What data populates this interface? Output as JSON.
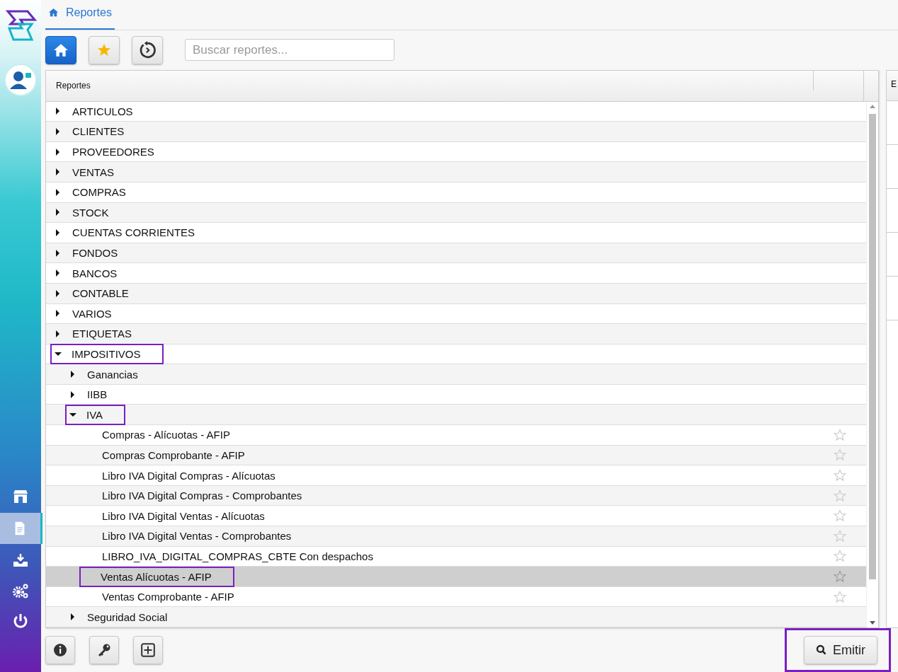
{
  "tab": {
    "label": "Reportes",
    "selected": true
  },
  "search": {
    "placeholder": "Buscar reportes..."
  },
  "table": {
    "column_1": "Reportes",
    "tree": [
      {
        "label": "ARTICULOS",
        "expanded": false,
        "highlighted": false
      },
      {
        "label": "CLIENTES",
        "expanded": false,
        "highlighted": false
      },
      {
        "label": "PROVEEDORES",
        "expanded": false,
        "highlighted": false
      },
      {
        "label": "VENTAS",
        "expanded": false,
        "highlighted": false
      },
      {
        "label": "COMPRAS",
        "expanded": false,
        "highlighted": false
      },
      {
        "label": "STOCK",
        "expanded": false,
        "highlighted": false
      },
      {
        "label": "CUENTAS CORRIENTES",
        "expanded": false,
        "highlighted": false
      },
      {
        "label": "FONDOS",
        "expanded": false,
        "highlighted": false
      },
      {
        "label": "BANCOS",
        "expanded": false,
        "highlighted": false
      },
      {
        "label": "CONTABLE",
        "expanded": false,
        "highlighted": false
      },
      {
        "label": "VARIOS",
        "expanded": false,
        "highlighted": false
      },
      {
        "label": "ETIQUETAS",
        "expanded": false,
        "highlighted": false
      },
      {
        "label": "IMPOSITIVOS",
        "expanded": true,
        "highlighted": true,
        "children": [
          {
            "label": "Ganancias",
            "expanded": false,
            "highlighted": false
          },
          {
            "label": "IIBB",
            "expanded": false,
            "highlighted": false
          },
          {
            "label": "IVA",
            "expanded": true,
            "highlighted": true,
            "children": [
              {
                "label": "Compras - Alícuotas - AFIP",
                "favorite": false,
                "selected": false,
                "highlighted": false
              },
              {
                "label": "Compras Comprobante - AFIP",
                "favorite": false,
                "selected": false,
                "highlighted": false
              },
              {
                "label": "Libro IVA Digital Compras - Alícuotas",
                "favorite": false,
                "selected": false,
                "highlighted": false
              },
              {
                "label": "Libro IVA Digital Compras - Comprobantes",
                "favorite": false,
                "selected": false,
                "highlighted": false
              },
              {
                "label": "Libro IVA Digital Ventas - Alícuotas",
                "favorite": false,
                "selected": false,
                "highlighted": false
              },
              {
                "label": "Libro IVA Digital Ventas - Comprobantes",
                "favorite": false,
                "selected": false,
                "highlighted": false
              },
              {
                "label": "LIBRO_IVA_DIGITAL_COMPRAS_CBTE Con despachos",
                "favorite": false,
                "selected": false,
                "highlighted": false
              },
              {
                "label": "Ventas Alícuotas - AFIP",
                "favorite": false,
                "selected": true,
                "highlighted": true
              },
              {
                "label": "Ventas Comprobante - AFIP",
                "favorite": false,
                "selected": false,
                "highlighted": false
              }
            ]
          },
          {
            "label": "Seguridad Social",
            "expanded": false,
            "highlighted": false
          }
        ]
      }
    ]
  },
  "side_panel": {
    "column_1": "E"
  },
  "emit_button": {
    "label": "Emitir",
    "highlighted": true
  }
}
